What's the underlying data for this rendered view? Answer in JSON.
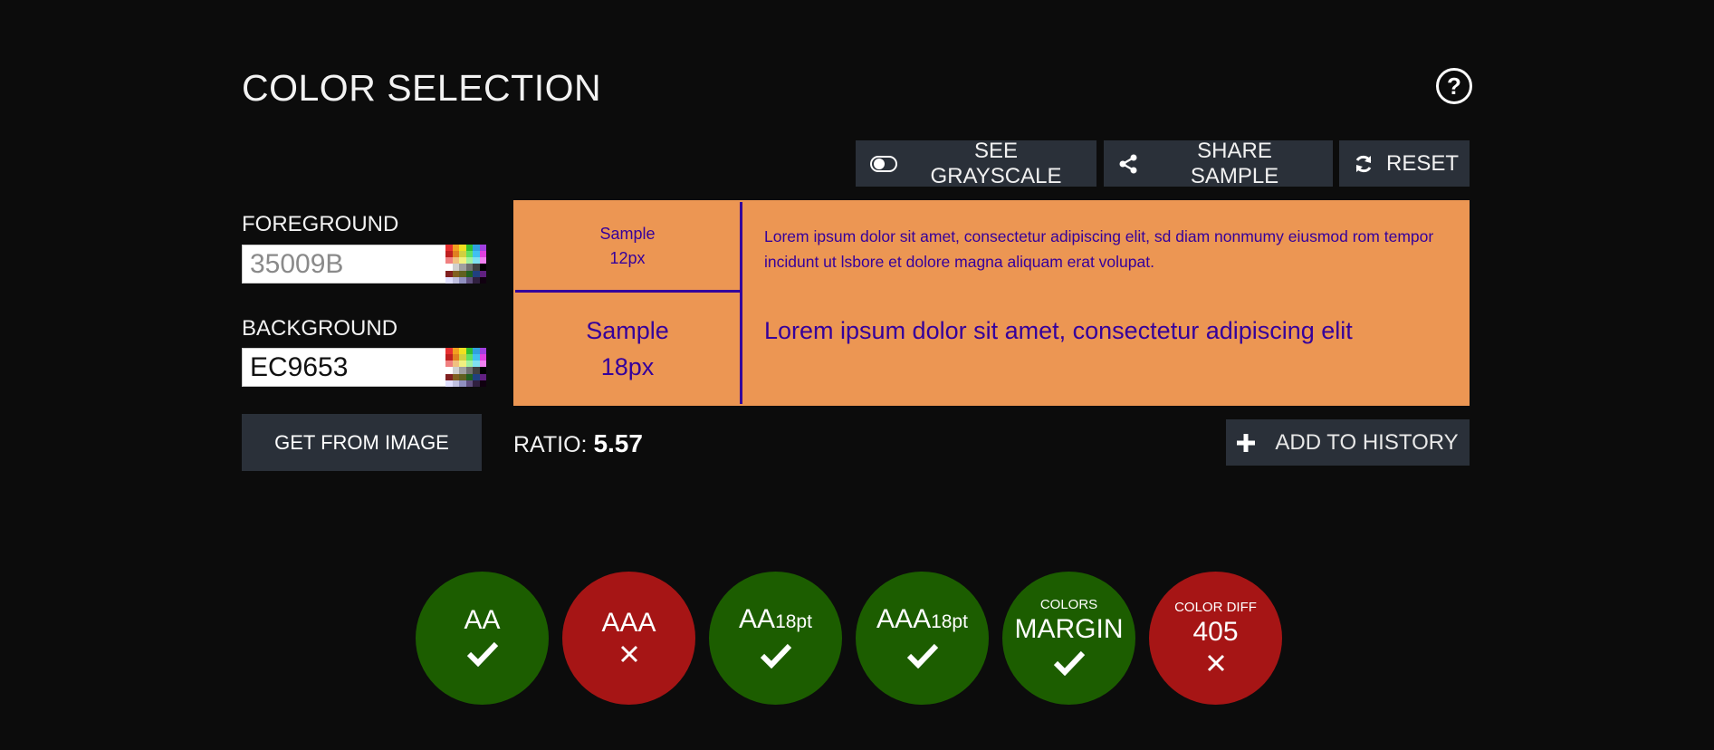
{
  "header": {
    "title": "COLOR SELECTION",
    "help_icon": "question-circle-icon"
  },
  "toolbar": {
    "grayscale_label": "SEE GRAYSCALE",
    "share_label": "SHARE SAMPLE",
    "reset_label": "RESET"
  },
  "inputs": {
    "foreground_label": "FOREGROUND",
    "foreground_value": "35009B",
    "background_label": "BACKGROUND",
    "background_value": "EC9653",
    "get_from_image_label": "GET FROM IMAGE"
  },
  "colors": {
    "foreground": "#35009b",
    "background": "#ec9653",
    "page_background": "#0c0c0c",
    "button_bg": "#2a3039",
    "pass": "#1c5d00",
    "fail": "#a61515"
  },
  "sample": {
    "small_label_line1": "Sample",
    "small_label_line2": "12px",
    "small_text": "Lorem ipsum dolor sit amet, consectetur adipiscing elit, sd diam nonmumy eiusmod rom tempor incidunt ut lsbore et dolore magna aliquam erat volupat.",
    "large_label_line1": "Sample",
    "large_label_line2": "18px",
    "large_text": "Lorem ipsum dolor sit amet, consectetur adipiscing elit"
  },
  "ratio": {
    "label": "RATIO:",
    "value": "5.57"
  },
  "history": {
    "add_label": "ADD TO HISTORY"
  },
  "results": [
    {
      "top": "",
      "main": "AA",
      "sub": "",
      "status": "pass"
    },
    {
      "top": "",
      "main": "AAA",
      "sub": "",
      "status": "fail"
    },
    {
      "top": "",
      "main": "AA",
      "sub": "18pt",
      "status": "pass"
    },
    {
      "top": "",
      "main": "AAA",
      "sub": "18pt",
      "status": "pass"
    },
    {
      "top": "COLORS",
      "main": "MARGIN",
      "sub": "",
      "status": "pass"
    },
    {
      "top": "COLOR DIFF",
      "main": "405",
      "sub": "",
      "status": "fail"
    }
  ]
}
